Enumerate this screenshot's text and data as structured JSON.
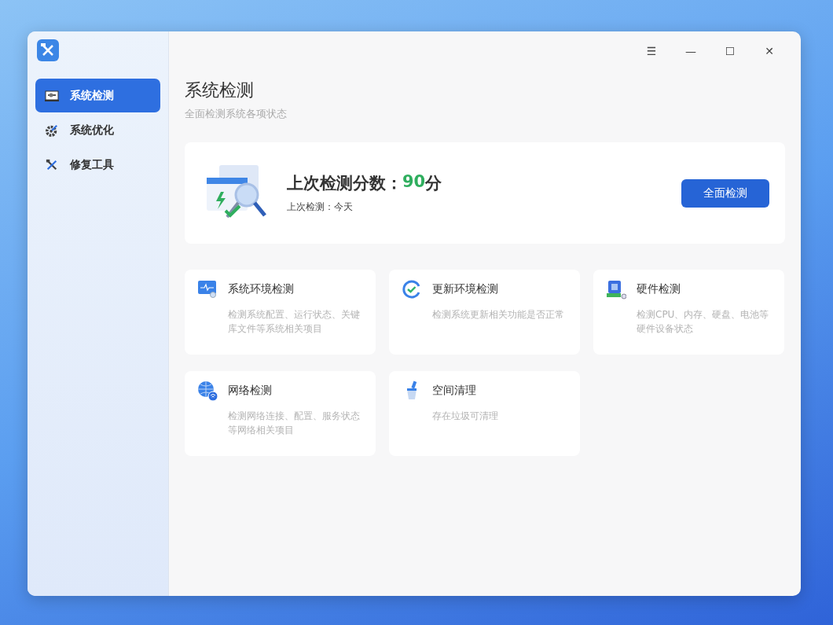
{
  "sidebar": {
    "items": [
      {
        "label": "系统检测",
        "kind": "monitor",
        "selected": true
      },
      {
        "label": "系统优化",
        "kind": "gear",
        "selected": false
      },
      {
        "label": "修复工具",
        "kind": "tools",
        "selected": false
      }
    ]
  },
  "window_controls": [
    "☰",
    "—",
    "☐",
    "✕"
  ],
  "page": {
    "title": "系统检测",
    "subtitle": "全面检测系统各项状态"
  },
  "score_card": {
    "label": "上次检测分数：",
    "score": "90",
    "unit": "分",
    "last_check": "上次检测：今天",
    "button": "全面检测"
  },
  "checks": [
    {
      "kind": "system",
      "title": "系统环境检测",
      "description": "检测系统配置、运行状态、关键库文件等系统相关项目"
    },
    {
      "kind": "update",
      "title": "更新环境检测",
      "description": "检测系统更新相关功能是否正常"
    },
    {
      "kind": "hardware",
      "title": "硬件检测",
      "description": "检测CPU、内存、硬盘、电池等硬件设备状态"
    },
    {
      "kind": "network",
      "title": "网络检测",
      "description": "检测网络连接、配置、服务状态等网络相关项目"
    },
    {
      "kind": "cleanup",
      "title": "空间清理",
      "description": "存在垃圾可清理"
    }
  ]
}
